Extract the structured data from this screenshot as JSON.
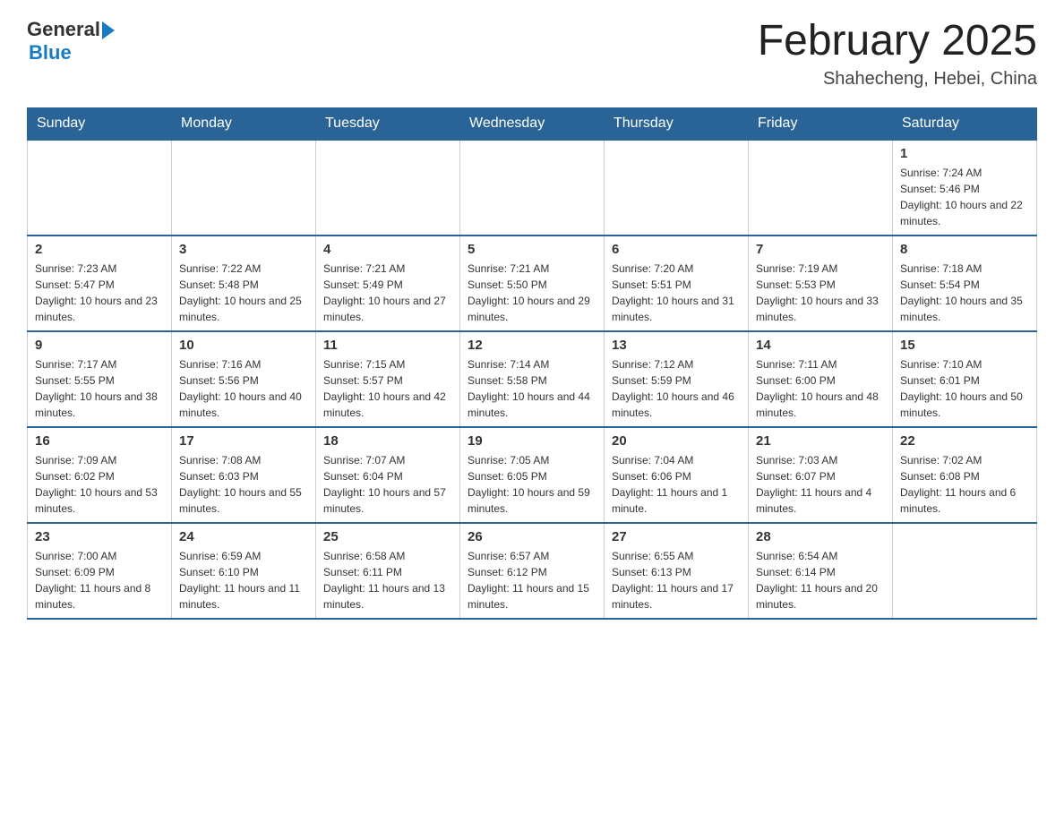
{
  "header": {
    "logo_general": "General",
    "logo_blue": "Blue",
    "month_title": "February 2025",
    "subtitle": "Shahecheng, Hebei, China"
  },
  "days_of_week": [
    "Sunday",
    "Monday",
    "Tuesday",
    "Wednesday",
    "Thursday",
    "Friday",
    "Saturday"
  ],
  "weeks": [
    [
      {
        "day": "",
        "info": ""
      },
      {
        "day": "",
        "info": ""
      },
      {
        "day": "",
        "info": ""
      },
      {
        "day": "",
        "info": ""
      },
      {
        "day": "",
        "info": ""
      },
      {
        "day": "",
        "info": ""
      },
      {
        "day": "1",
        "info": "Sunrise: 7:24 AM\nSunset: 5:46 PM\nDaylight: 10 hours and 22 minutes."
      }
    ],
    [
      {
        "day": "2",
        "info": "Sunrise: 7:23 AM\nSunset: 5:47 PM\nDaylight: 10 hours and 23 minutes."
      },
      {
        "day": "3",
        "info": "Sunrise: 7:22 AM\nSunset: 5:48 PM\nDaylight: 10 hours and 25 minutes."
      },
      {
        "day": "4",
        "info": "Sunrise: 7:21 AM\nSunset: 5:49 PM\nDaylight: 10 hours and 27 minutes."
      },
      {
        "day": "5",
        "info": "Sunrise: 7:21 AM\nSunset: 5:50 PM\nDaylight: 10 hours and 29 minutes."
      },
      {
        "day": "6",
        "info": "Sunrise: 7:20 AM\nSunset: 5:51 PM\nDaylight: 10 hours and 31 minutes."
      },
      {
        "day": "7",
        "info": "Sunrise: 7:19 AM\nSunset: 5:53 PM\nDaylight: 10 hours and 33 minutes."
      },
      {
        "day": "8",
        "info": "Sunrise: 7:18 AM\nSunset: 5:54 PM\nDaylight: 10 hours and 35 minutes."
      }
    ],
    [
      {
        "day": "9",
        "info": "Sunrise: 7:17 AM\nSunset: 5:55 PM\nDaylight: 10 hours and 38 minutes."
      },
      {
        "day": "10",
        "info": "Sunrise: 7:16 AM\nSunset: 5:56 PM\nDaylight: 10 hours and 40 minutes."
      },
      {
        "day": "11",
        "info": "Sunrise: 7:15 AM\nSunset: 5:57 PM\nDaylight: 10 hours and 42 minutes."
      },
      {
        "day": "12",
        "info": "Sunrise: 7:14 AM\nSunset: 5:58 PM\nDaylight: 10 hours and 44 minutes."
      },
      {
        "day": "13",
        "info": "Sunrise: 7:12 AM\nSunset: 5:59 PM\nDaylight: 10 hours and 46 minutes."
      },
      {
        "day": "14",
        "info": "Sunrise: 7:11 AM\nSunset: 6:00 PM\nDaylight: 10 hours and 48 minutes."
      },
      {
        "day": "15",
        "info": "Sunrise: 7:10 AM\nSunset: 6:01 PM\nDaylight: 10 hours and 50 minutes."
      }
    ],
    [
      {
        "day": "16",
        "info": "Sunrise: 7:09 AM\nSunset: 6:02 PM\nDaylight: 10 hours and 53 minutes."
      },
      {
        "day": "17",
        "info": "Sunrise: 7:08 AM\nSunset: 6:03 PM\nDaylight: 10 hours and 55 minutes."
      },
      {
        "day": "18",
        "info": "Sunrise: 7:07 AM\nSunset: 6:04 PM\nDaylight: 10 hours and 57 minutes."
      },
      {
        "day": "19",
        "info": "Sunrise: 7:05 AM\nSunset: 6:05 PM\nDaylight: 10 hours and 59 minutes."
      },
      {
        "day": "20",
        "info": "Sunrise: 7:04 AM\nSunset: 6:06 PM\nDaylight: 11 hours and 1 minute."
      },
      {
        "day": "21",
        "info": "Sunrise: 7:03 AM\nSunset: 6:07 PM\nDaylight: 11 hours and 4 minutes."
      },
      {
        "day": "22",
        "info": "Sunrise: 7:02 AM\nSunset: 6:08 PM\nDaylight: 11 hours and 6 minutes."
      }
    ],
    [
      {
        "day": "23",
        "info": "Sunrise: 7:00 AM\nSunset: 6:09 PM\nDaylight: 11 hours and 8 minutes."
      },
      {
        "day": "24",
        "info": "Sunrise: 6:59 AM\nSunset: 6:10 PM\nDaylight: 11 hours and 11 minutes."
      },
      {
        "day": "25",
        "info": "Sunrise: 6:58 AM\nSunset: 6:11 PM\nDaylight: 11 hours and 13 minutes."
      },
      {
        "day": "26",
        "info": "Sunrise: 6:57 AM\nSunset: 6:12 PM\nDaylight: 11 hours and 15 minutes."
      },
      {
        "day": "27",
        "info": "Sunrise: 6:55 AM\nSunset: 6:13 PM\nDaylight: 11 hours and 17 minutes."
      },
      {
        "day": "28",
        "info": "Sunrise: 6:54 AM\nSunset: 6:14 PM\nDaylight: 11 hours and 20 minutes."
      },
      {
        "day": "",
        "info": ""
      }
    ]
  ]
}
